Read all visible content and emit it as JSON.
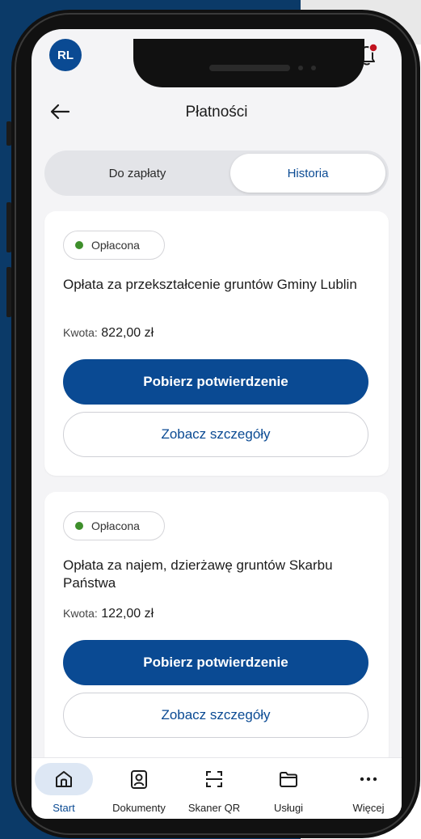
{
  "status": {
    "avatar_initials": "RL",
    "notification_icon": "bell-icon"
  },
  "header": {
    "title": "Płatności",
    "back_icon": "arrow-left-icon"
  },
  "tabs": [
    {
      "label": "Do zapłaty",
      "active": false
    },
    {
      "label": "Historia",
      "active": true
    }
  ],
  "payments": [
    {
      "status": "Opłacona",
      "title": "Opłata za przekształcenie gruntów Gminy Lublin",
      "amount_label": "Kwota:",
      "amount": "822,00 zł",
      "primary_button": "Pobierz potwierdzenie",
      "secondary_button": "Zobacz szczegóły"
    },
    {
      "status": "Opłacona",
      "title": "Opłata za najem, dzierżawę gruntów Skarbu Państwa",
      "amount_label": "Kwota:",
      "amount": "122,00 zł",
      "primary_button": "Pobierz potwierdzenie",
      "secondary_button": "Zobacz szczegóły"
    }
  ],
  "bottom_nav": [
    {
      "label": "Start",
      "icon": "home-icon",
      "active": true
    },
    {
      "label": "Dokumenty",
      "icon": "id-card-icon",
      "active": false
    },
    {
      "label": "Skaner QR",
      "icon": "qr-scanner-icon",
      "active": false
    },
    {
      "label": "Usługi",
      "icon": "folder-icon",
      "active": false
    },
    {
      "label": "Więcej",
      "icon": "more-icon",
      "active": false
    }
  ],
  "colors": {
    "primary": "#0a4a93",
    "status_paid": "#3e8f2b",
    "background": "#0b3a68"
  }
}
